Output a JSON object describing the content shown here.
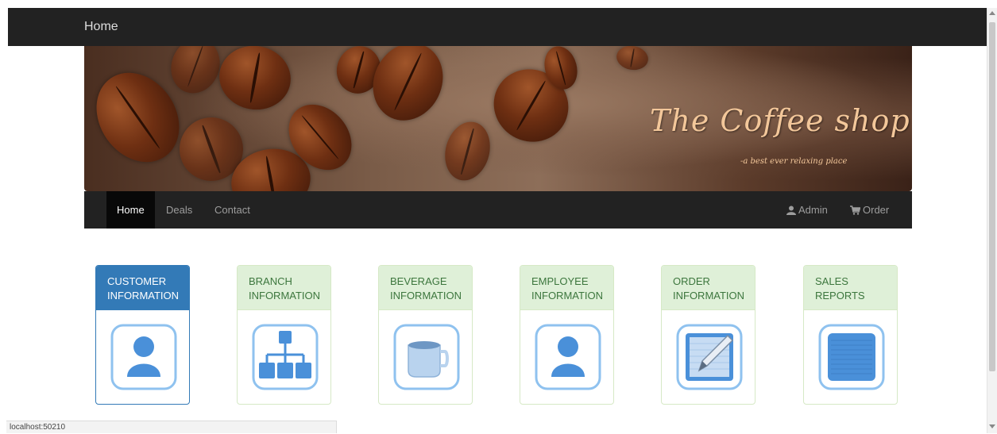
{
  "topbar": {
    "brand": "Home"
  },
  "banner": {
    "title": "The Coffee shop",
    "subtitle": "-a best ever relaxing place"
  },
  "nav": {
    "items": [
      {
        "label": "Home",
        "active": true
      },
      {
        "label": "Deals",
        "active": false
      },
      {
        "label": "Contact",
        "active": false
      }
    ],
    "right": [
      {
        "label": "Admin",
        "icon": "user-icon"
      },
      {
        "label": "Order",
        "icon": "cart-icon"
      }
    ]
  },
  "tiles": [
    {
      "line1": "CUSTOMER",
      "line2": "INFORMATION",
      "icon": "person-icon",
      "selected": true
    },
    {
      "line1": "BRANCH",
      "line2": "INFORMATION",
      "icon": "org-chart-icon",
      "selected": false
    },
    {
      "line1": "BEVERAGE",
      "line2": "INFORMATION",
      "icon": "mug-icon",
      "selected": false
    },
    {
      "line1": "EMPLOYEE",
      "line2": "INFORMATION",
      "icon": "person-icon",
      "selected": false
    },
    {
      "line1": "ORDER",
      "line2": "INFORMATION",
      "icon": "pencil-note-icon",
      "selected": false
    },
    {
      "line1": "SALES",
      "line2": "REPORTS",
      "icon": "report-icon",
      "selected": false
    }
  ],
  "status": {
    "url": "localhost:50210"
  },
  "colors": {
    "primary": "#337ab7",
    "success_bg": "#dff0d8",
    "success_text": "#3c763d",
    "navbar": "#222222",
    "banner_text": "#f3c79a",
    "icon_blue": "#4a90d9"
  }
}
